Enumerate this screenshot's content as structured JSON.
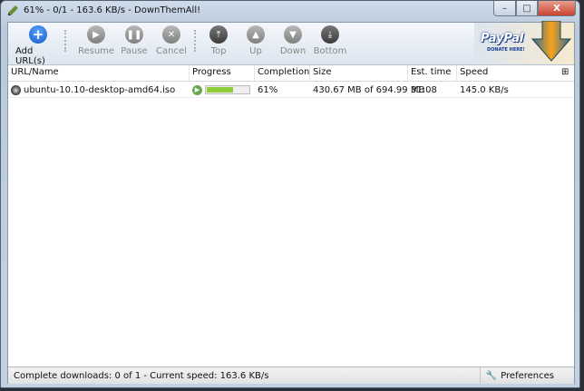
{
  "window": {
    "title": "61% - 0/1 - 163.6 KB/s - DownThemAll!",
    "controls": {
      "minimize": "–",
      "maximize": "□",
      "close": "X"
    }
  },
  "toolbar": {
    "add": {
      "label": "Add URL(s)",
      "icon": "+"
    },
    "resume": {
      "label": "Resume",
      "icon": "▶"
    },
    "pause": {
      "label": "Pause",
      "icon": "❚❚"
    },
    "cancel": {
      "label": "Cancel",
      "icon": "✕"
    },
    "top": {
      "label": "Top",
      "icon": "⤒"
    },
    "up": {
      "label": "Up",
      "icon": "▲"
    },
    "down": {
      "label": "Down",
      "icon": "▼"
    },
    "bottom": {
      "label": "Bottom",
      "icon": "⤓"
    },
    "paypal": {
      "brand": "PayPal",
      "sub": "DONATE HERE!"
    }
  },
  "columns": [
    "URL/Name",
    "Progress",
    "Completion",
    "Size",
    "Est. time",
    "Speed"
  ],
  "downloads": [
    {
      "name": "ubuntu-10.10-desktop-amd64.iso",
      "progress": 61,
      "completion": "61%",
      "size": "430.67 MB of 694.99 MB",
      "eta": "31:08",
      "speed": "145.0 KB/s"
    }
  ],
  "status": {
    "text": "Complete downloads: 0 of 1 - Current speed: 163.6 KB/s",
    "preferences": "Preferences"
  },
  "colors": {
    "progress": "#8fcc3a",
    "accent": "#1657c4"
  }
}
